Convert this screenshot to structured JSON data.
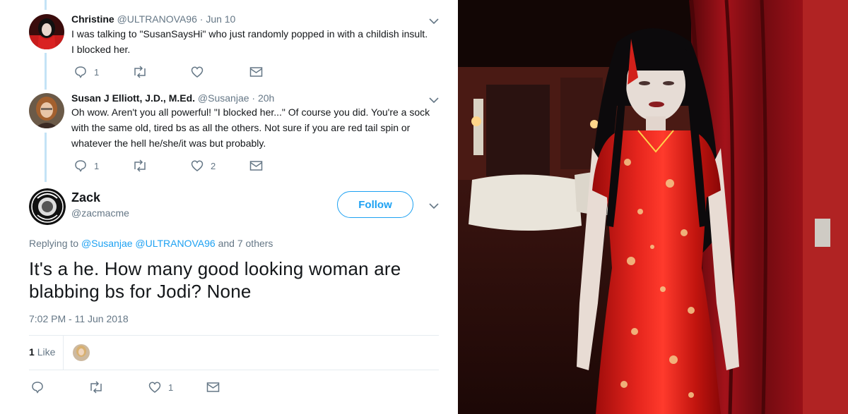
{
  "tweets": [
    {
      "display_name": "Christine",
      "handle": "@ULTRANOVA96",
      "time": "Jun 10",
      "text": "I was talking to \"SusanSaysHi\" who just randomly popped in with a childish insult. I blocked her.",
      "replies": "1",
      "retweets": "",
      "likes": ""
    },
    {
      "display_name": "Susan J Elliott, J.D., M.Ed.",
      "handle": "@Susanjae",
      "time": "20h",
      "text": "Oh wow.  Aren't you all powerful!  \"I blocked her...\"  Of course you did.  You're a sock with the same old, tired bs as all the others.  Not sure if you are red tail spin or whatever the hell he/she/it was but probably.",
      "replies": "1",
      "retweets": "",
      "likes": "2"
    }
  ],
  "main_tweet": {
    "display_name": "Zack",
    "handle": "@zacmacme",
    "follow_label": "Follow",
    "replying_prefix": "Replying to",
    "replying_to_1": "@Susanjae",
    "replying_to_2": "@ULTRANOVA96",
    "replying_suffix": "and 7 others",
    "text": "It's a he.  How many good looking woman are blabbing bs for Jodi?  None",
    "timestamp": "7:02 PM - 11 Jun 2018",
    "like_count": "1",
    "like_label": "Like",
    "action_likes": "1"
  },
  "icons": {
    "reply": "reply-icon",
    "retweet": "retweet-icon",
    "like": "heart-icon",
    "dm": "envelope-icon",
    "more": "chevron-down-icon"
  },
  "colors": {
    "accent": "#1da1f2",
    "thread_line": "#c4e3f6",
    "muted_text": "#657786",
    "dress_red": "#d41a1a",
    "curtain_red": "#8e0f14"
  }
}
